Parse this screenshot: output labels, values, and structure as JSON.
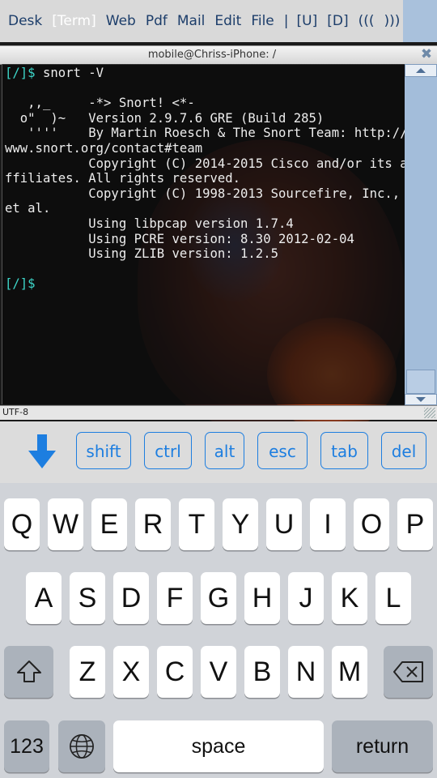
{
  "menubar": {
    "items": [
      "Desk",
      "[Term]",
      "Web",
      "Pdf",
      "Mail",
      "Edit",
      "File"
    ],
    "separator": "|",
    "extras": [
      "[U]",
      "[D]",
      "(((",
      ")))"
    ],
    "active_color": "#ffffff",
    "text_color": "#1c3d6a"
  },
  "window": {
    "title": "mobile@Chriss-iPhone: /",
    "close_glyph": "✖"
  },
  "terminal": {
    "prompt": "[/]$",
    "command": " snort -V",
    "output": [
      "",
      "   ,,_     -*> Snort! <*-",
      "  o\"  )~   Version 2.9.7.6 GRE (Build 285)",
      "   ''''    By Martin Roesch & The Snort Team: http://",
      "www.snort.org/contact#team",
      "           Copyright (C) 2014-2015 Cisco and/or its a",
      "ffiliates. All rights reserved.",
      "           Copyright (C) 1998-2013 Sourcefire, Inc.,",
      "et al.",
      "           Using libpcap version 1.7.4",
      "           Using PCRE version: 8.30 2012-02-04",
      "           Using ZLIB version: 1.2.5",
      ""
    ],
    "prompt_color": "#3dd6c9"
  },
  "statusbar": {
    "encoding": "UTF-8"
  },
  "extra_keys": [
    "shift",
    "ctrl",
    "alt",
    "esc",
    "tab",
    "del"
  ],
  "keyboard": {
    "row1": [
      "Q",
      "W",
      "E",
      "R",
      "T",
      "Y",
      "U",
      "I",
      "O",
      "P"
    ],
    "row2": [
      "A",
      "S",
      "D",
      "F",
      "G",
      "H",
      "J",
      "K",
      "L"
    ],
    "row3": [
      "Z",
      "X",
      "C",
      "V",
      "B",
      "N",
      "M"
    ],
    "numbers_key": "123",
    "space_key": "space",
    "return_key": "return",
    "accent_color": "#1d7ee0"
  }
}
